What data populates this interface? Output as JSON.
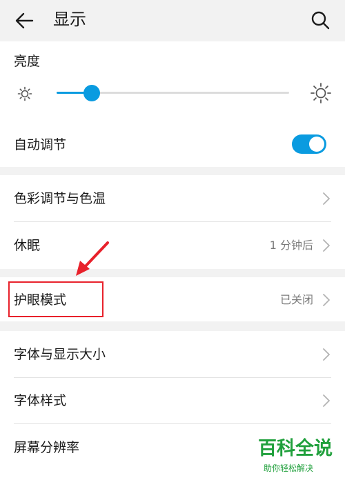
{
  "header": {
    "title": "显示"
  },
  "brightness": {
    "label": "亮度",
    "level": 0.15
  },
  "auto_adjust": {
    "label": "自动调节",
    "enabled": true
  },
  "color_section": {
    "color_temp": {
      "label": "色彩调节与色温"
    },
    "sleep": {
      "label": "休眠",
      "value": "1 分钟后"
    }
  },
  "eye_care": {
    "label": "护眼模式",
    "value": "已关闭"
  },
  "font_section": {
    "font_size": {
      "label": "字体与显示大小"
    },
    "font_style": {
      "label": "字体样式"
    },
    "resolution": {
      "label": "屏幕分辨率"
    }
  },
  "watermark": {
    "title": "百科全说",
    "subtitle": "助你轻松解决"
  },
  "colors": {
    "accent": "#0a9be0",
    "highlight": "#e8212b",
    "watermark": "#20a03c"
  },
  "icons": [
    "back-arrow-icon",
    "search-icon",
    "brightness-low-icon",
    "brightness-high-icon",
    "chevron-right-icon"
  ]
}
